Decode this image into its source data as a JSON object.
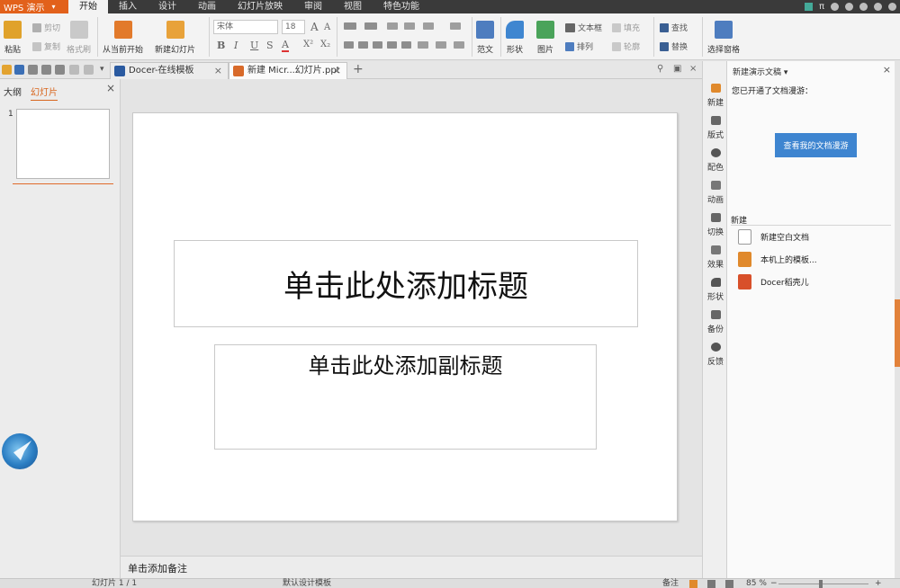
{
  "app": {
    "name": "WPS 演示"
  },
  "menu": {
    "tabs": [
      "开始",
      "插入",
      "设计",
      "动画",
      "幻灯片放映",
      "审阅",
      "视图",
      "特色功能"
    ],
    "active": "开始",
    "right_glyph": "π"
  },
  "ribbon": {
    "paste": "粘贴",
    "cut": "剪切",
    "copy": "复制",
    "format_painter": "格式刷",
    "from_current": "从当前开始",
    "new_slide": "新建幻灯片",
    "font_name": "宋体",
    "font_size": "18",
    "grow": "A",
    "shrink": "A",
    "bold": "B",
    "italic": "I",
    "underline": "U",
    "strike": "S",
    "font_color": "A",
    "superscript": "X²",
    "subscript": "X₂",
    "fanwen": "范文",
    "shape": "形状",
    "picture": "图片",
    "textbox": "文本框",
    "arrange": "排列",
    "fill": "填充",
    "outline": "轮廓",
    "find": "查找",
    "replace": "替换",
    "select_pane": "选择窗格",
    "icon_colors": {
      "paste": "#e0a22b",
      "start": "#e27a2b",
      "newslide": "#e8a23a",
      "fanwen": "#4e7dbf",
      "shape": "#3f86d0",
      "picture": "#4aa35a",
      "selectpane": "#4e7dbf"
    }
  },
  "tabs": [
    {
      "label": "Docer-在线模板",
      "close": "×"
    },
    {
      "label": "新建 Micr...幻灯片.ppt",
      "close": "×"
    }
  ],
  "tabstrip": {
    "plus": "+"
  },
  "left_panel": {
    "tabs": [
      "大纲",
      "幻灯片"
    ],
    "active": "幻灯片",
    "close": "×",
    "slide_number": "1"
  },
  "slide": {
    "title_placeholder": "单击此处添加标题",
    "subtitle_placeholder": "单击此处添加副标题"
  },
  "notes": {
    "placeholder": "单击添加备注"
  },
  "side_toolbar": {
    "items": [
      "新建",
      "版式",
      "配色",
      "动画",
      "切换",
      "效果",
      "形状",
      "备份",
      "反馈"
    ]
  },
  "task_pane": {
    "title": "新建演示文稿 ▾",
    "close": "×",
    "roaming_text": "您已开通了文档漫游：",
    "roaming_button": "查看我的文档漫游",
    "section": "新建",
    "items": [
      "新建空白文档",
      "本机上的模板...",
      "Docer稻壳儿"
    ]
  },
  "status": {
    "slide_info": "幻灯片 1 / 1",
    "template": "默认设计模板",
    "notes_toggle": "备注",
    "zoom": "85 %",
    "zoom_level": 0.85
  }
}
